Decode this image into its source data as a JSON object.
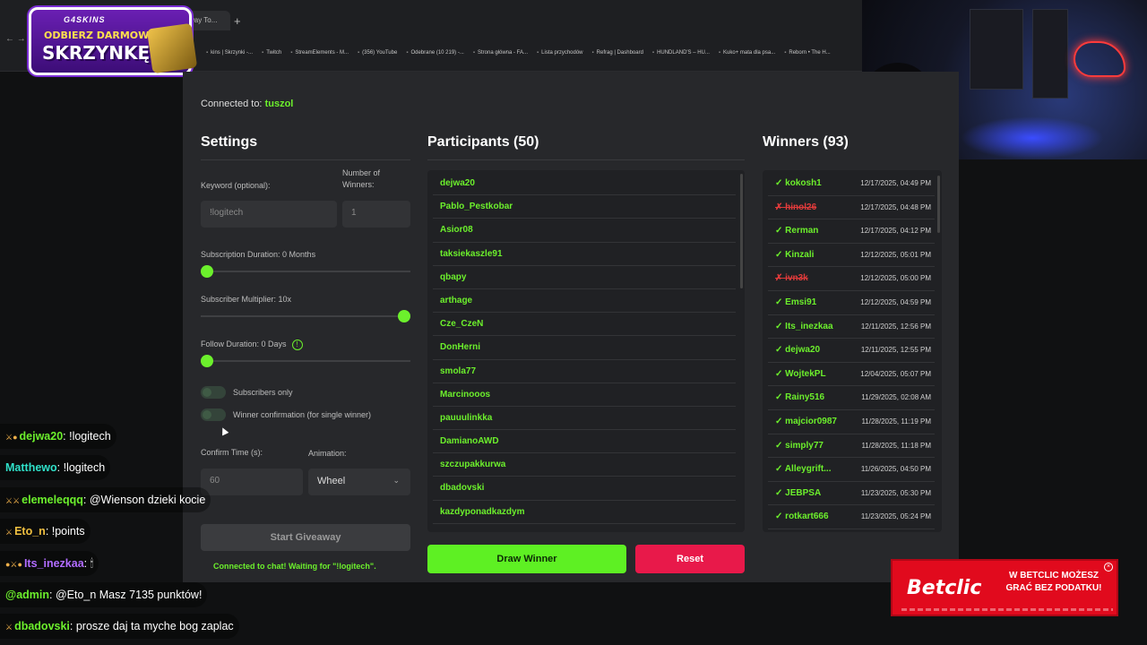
{
  "browser": {
    "tab_label": "way To...",
    "new_tab": "+",
    "nav": "←  →",
    "bookmarks": [
      "kins | Skrzynki -...",
      "Twitch",
      "StreamElements - M...",
      "(356) YouTube",
      "Odebrane (10 219) -...",
      "Strona główna - FA...",
      "Lista przychodów",
      "Refrag | Dashboard",
      "HUNDLAND'S – HU...",
      "Kuko+ mata dla psa...",
      "Reborn • The H..."
    ]
  },
  "promo": {
    "brand": "G4SKINS",
    "line1": "ODBIERZ DARMOWĄ",
    "line2": "SKRZYNKĘ!"
  },
  "app": {
    "connected_prefix": "Connected to: ",
    "channel": "tuszol",
    "settings": {
      "title": "Settings",
      "keyword_label": "Keyword (optional):",
      "keyword_value": "!logitech",
      "winners_label": "Number of Winners:",
      "winners_value": "1",
      "sub_duration_label": "Subscription Duration: 0 Months",
      "sub_duration_level": 0,
      "multiplier_label": "Subscriber Multiplier: 10x",
      "multiplier_level": 1,
      "follow_label": "Follow Duration: 0 Days",
      "follow_level": 0,
      "info_icon": "!",
      "subs_only_label": "Subscribers only",
      "confirm_label": "Winner confirmation (for single winner)",
      "confirm_time_label": "Confirm Time (s):",
      "confirm_time_value": "60",
      "animation_label": "Animation:",
      "animation_value": "Wheel",
      "start_button": "Start Giveaway",
      "status": "Connected to chat! Waiting for \"!logitech\"."
    },
    "participants": {
      "title": "Participants (50)",
      "items": [
        "dejwa20",
        "Pablo_Pestkobar",
        "Asior08",
        "taksiekaszle91",
        "qbapy",
        "arthage",
        "Cze_CzeN",
        "DonHerni",
        "smola77",
        "Marcinooos",
        "pauuulinkka",
        "DamianoAWD",
        "szczupakkurwa",
        "dbadovski",
        "kazdyponadkazdym"
      ]
    },
    "winners": {
      "title": "Winners (93)",
      "items": [
        {
          "mark": "✓",
          "name": "kokosh1",
          "date": "12/17/2025, 04:49 PM",
          "rejected": false
        },
        {
          "mark": "✗",
          "name": "hinol26",
          "date": "12/17/2025, 04:48 PM",
          "rejected": true
        },
        {
          "mark": "✓",
          "name": "Rerman",
          "date": "12/17/2025, 04:12 PM",
          "rejected": false
        },
        {
          "mark": "✓",
          "name": "Kinzali",
          "date": "12/12/2025, 05:01 PM",
          "rejected": false
        },
        {
          "mark": "✗",
          "name": "ivn3k",
          "date": "12/12/2025, 05:00 PM",
          "rejected": true
        },
        {
          "mark": "✓",
          "name": "Emsi91",
          "date": "12/12/2025, 04:59 PM",
          "rejected": false
        },
        {
          "mark": "✓",
          "name": "Its_inezkaa",
          "date": "12/11/2025, 12:56 PM",
          "rejected": false
        },
        {
          "mark": "✓",
          "name": "dejwa20",
          "date": "12/11/2025, 12:55 PM",
          "rejected": false
        },
        {
          "mark": "✓",
          "name": "WojtekPL",
          "date": "12/04/2025, 05:07 PM",
          "rejected": false
        },
        {
          "mark": "✓",
          "name": "Rainy516",
          "date": "11/29/2025, 02:08 AM",
          "rejected": false
        },
        {
          "mark": "✓",
          "name": "majcior0987",
          "date": "11/28/2025, 11:19 PM",
          "rejected": false
        },
        {
          "mark": "✓",
          "name": "simply77",
          "date": "11/28/2025, 11:18 PM",
          "rejected": false
        },
        {
          "mark": "✓",
          "name": "Alleygrift...",
          "date": "11/26/2025, 04:50 PM",
          "rejected": false
        },
        {
          "mark": "✓",
          "name": "JEBPSA",
          "date": "11/23/2025, 05:30 PM",
          "rejected": false
        },
        {
          "mark": "✓",
          "name": "rotkart666",
          "date": "11/23/2025, 05:24 PM",
          "rejected": false
        }
      ]
    },
    "draw_button": "Draw Winner",
    "reset_button": "Reset"
  },
  "chat": [
    {
      "badge": "⚔●",
      "user": "dejwa20",
      "color": "#6cf02c",
      "msg": ": !logitech"
    },
    {
      "badge": "",
      "user": "Matthewo",
      "color": "#2fe0c8",
      "msg": ": !logitech"
    },
    {
      "badge": "⚔⚔",
      "user": "elemeleqqq",
      "color": "#6cf02c",
      "msg": ": @Wienson dzieki kocie"
    },
    {
      "badge": "⚔",
      "user": "Eto_n",
      "color": "#f0c040",
      "msg": ": !points"
    },
    {
      "badge": "●⚔●",
      "user": "Its_inezkaa",
      "color": "#b16cff",
      "msg": ": 🕯"
    },
    {
      "badge": "",
      "user": "@admin",
      "color": "#6cf02c",
      "msg": ": @Eto_n Masz 7135 punktów!"
    },
    {
      "badge": "⚔",
      "user": "dbadovski",
      "color": "#6cf02c",
      "msg": ": prosze daj ta myche bog zaplac"
    }
  ],
  "ad": {
    "logo": "Betclic",
    "text": "W BETCLIC MOŻESZ GRAĆ BEZ PODATKU!",
    "close": "×"
  },
  "colors": {
    "accent": "#6cf02c",
    "danger": "#e8194a",
    "panel": "#27282b"
  }
}
